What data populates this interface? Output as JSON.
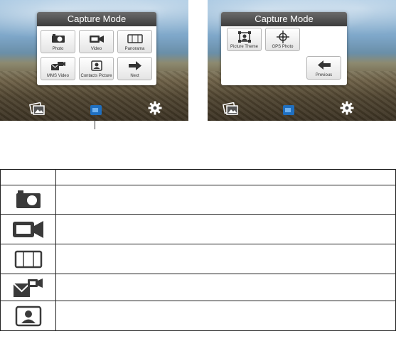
{
  "left_screen": {
    "menu_title": "Capture Mode",
    "buttons": [
      {
        "label": "Photo",
        "icon": "camera-icon"
      },
      {
        "label": "Video",
        "icon": "video-camera-icon"
      },
      {
        "label": "Panorama",
        "icon": "panorama-icon"
      },
      {
        "label": "MMS Video",
        "icon": "mms-video-icon"
      },
      {
        "label": "Contacts Picture",
        "icon": "contacts-picture-icon"
      },
      {
        "label": "Next",
        "icon": "arrow-right-icon"
      }
    ]
  },
  "right_screen": {
    "menu_title": "Capture Mode",
    "buttons": [
      {
        "label": "Picture Theme",
        "icon": "picture-theme-icon"
      },
      {
        "label": "GPS Photo",
        "icon": "gps-crosshair-icon"
      },
      {
        "label": "Previous",
        "icon": "arrow-left-icon"
      }
    ]
  },
  "bottom_bar_icons": [
    "album-icon",
    "capture-mode-icon",
    "settings-gear-icon"
  ],
  "table": {
    "header": [
      "",
      ""
    ],
    "rows": [
      {
        "icon": "camera-icon"
      },
      {
        "icon": "video-camera-icon"
      },
      {
        "icon": "panorama-icon"
      },
      {
        "icon": "mms-video-icon"
      },
      {
        "icon": "contacts-picture-icon"
      }
    ]
  },
  "colors": {
    "menu_title_bg": "#3c3c3c",
    "active_mode_icon": "#1f6fc0"
  }
}
